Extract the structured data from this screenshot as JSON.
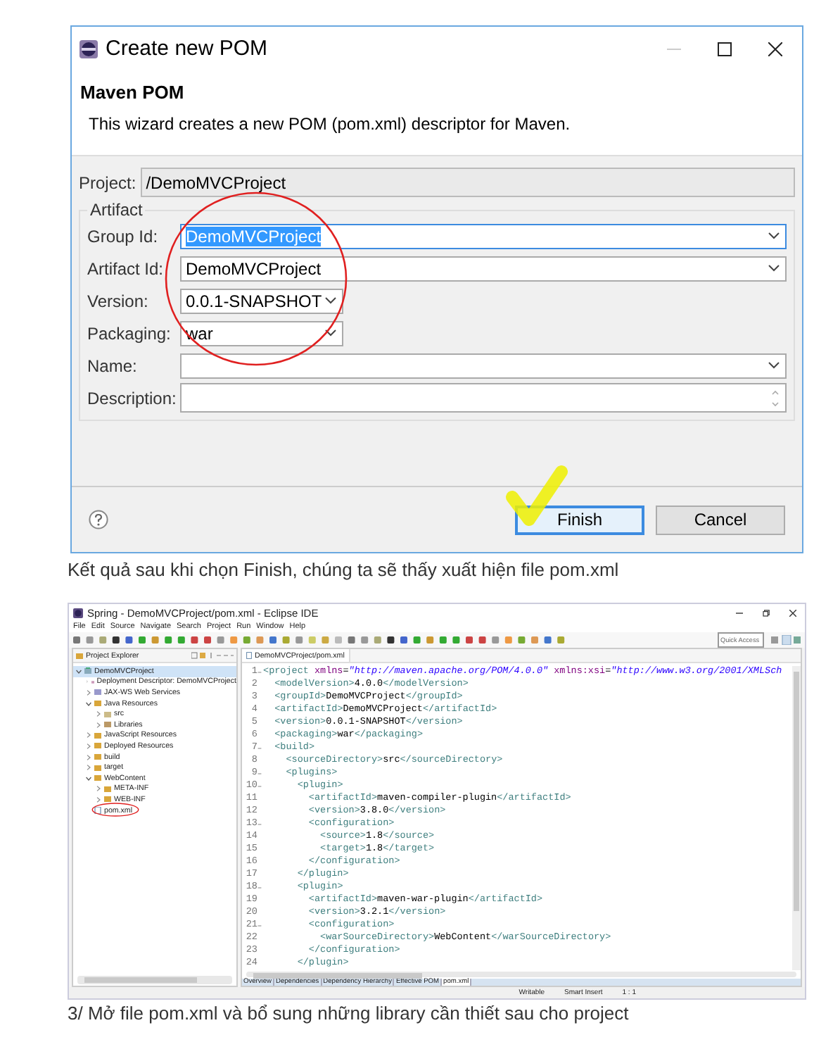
{
  "dialog": {
    "title": "Create new POM",
    "heading": "Maven POM",
    "description": "This wizard creates a new POM (pom.xml) descriptor for Maven.",
    "project": {
      "label": "Project:",
      "value": "/DemoMVCProject"
    },
    "group_title": "Artifact",
    "fields": [
      {
        "label": "Group Id:",
        "value": "DemoMVCProject",
        "kind": "combo",
        "selected": true
      },
      {
        "label": "Artifact Id:",
        "value": "DemoMVCProject",
        "kind": "combo",
        "selected": false
      },
      {
        "label": "Version:",
        "value": "0.0.1-SNAPSHOT",
        "kind": "short",
        "selected": false
      },
      {
        "label": "Packaging:",
        "value": "war",
        "kind": "short",
        "selected": false
      },
      {
        "label": "Name:",
        "kind": "combo",
        "selected": false
      },
      {
        "label": "Description:",
        "kind": "memo",
        "selected": false
      }
    ],
    "buttons": [
      {
        "label": "Finish",
        "default": true
      },
      {
        "label": "Cancel",
        "default": false
      }
    ]
  },
  "caption_1": "Kết quả sau khi chọn Finish, chúng ta sẽ thấy xuất hiện file pom.xml",
  "eclipse": {
    "title": "Spring - DemoMVCProject/pom.xml - Eclipse IDE",
    "menu": [
      "File",
      "Edit",
      "Source",
      "Navigate",
      "Search",
      "Project",
      "Run",
      "Window",
      "Help"
    ],
    "quick_access": {
      "placeholder": "Quick Access"
    },
    "explorer": {
      "title": "Project Explorer",
      "tree": [
        {
          "label": "DemoMVCProject",
          "kind": "project",
          "expanded": true,
          "selected": true,
          "marked": false,
          "children": [
            {
              "label": "Deployment Descriptor: DemoMVCProject",
              "kind": "descriptor",
              "expanded": false,
              "selected": false,
              "marked": false
            },
            {
              "label": "JAX-WS Web Services",
              "kind": "service",
              "expanded": false,
              "selected": false,
              "marked": false
            },
            {
              "label": "Java Resources",
              "kind": "folder",
              "expanded": true,
              "selected": false,
              "marked": false,
              "children": [
                {
                  "label": "src",
                  "kind": "package",
                  "expanded": false,
                  "selected": false,
                  "marked": false
                },
                {
                  "label": "Libraries",
                  "kind": "library",
                  "expanded": false,
                  "selected": false,
                  "marked": false
                }
              ]
            },
            {
              "label": "JavaScript Resources",
              "kind": "folder",
              "expanded": false,
              "selected": false,
              "marked": false
            },
            {
              "label": "Deployed Resources",
              "kind": "folder",
              "expanded": false,
              "selected": false,
              "marked": false
            },
            {
              "label": "build",
              "kind": "folder",
              "expanded": false,
              "selected": false,
              "marked": false
            },
            {
              "label": "target",
              "kind": "folder",
              "expanded": false,
              "selected": false,
              "marked": false
            },
            {
              "label": "WebContent",
              "kind": "folder",
              "expanded": true,
              "selected": false,
              "marked": false,
              "children": [
                {
                  "label": "META-INF",
                  "kind": "folder",
                  "expanded": false,
                  "selected": false,
                  "marked": false
                },
                {
                  "label": "WEB-INF",
                  "kind": "folder",
                  "expanded": false,
                  "selected": false,
                  "marked": false
                }
              ]
            },
            {
              "label": "pom.xml",
              "kind": "file",
              "selected": false,
              "marked": true
            }
          ]
        }
      ]
    },
    "editor": {
      "tab": "DemoMVCProject/pom.xml",
      "lines": [
        {
          "number": "1",
          "fold": true,
          "text": "<project xmlns=\"http://maven.apache.org/POM/4.0.0\" xmlns:xsi=\"http://www.w3.org/2001/XMLSch"
        },
        {
          "number": "2",
          "fold": false,
          "text": "  <modelVersion>4.0.0</modelVersion>"
        },
        {
          "number": "3",
          "fold": false,
          "text": "  <groupId>DemoMVCProject</groupId>"
        },
        {
          "number": "4",
          "fold": false,
          "text": "  <artifactId>DemoMVCProject</artifactId>"
        },
        {
          "number": "5",
          "fold": false,
          "text": "  <version>0.0.1-SNAPSHOT</version>"
        },
        {
          "number": "6",
          "fold": false,
          "text": "  <packaging>war</packaging>"
        },
        {
          "number": "7",
          "fold": true,
          "text": "  <build>"
        },
        {
          "number": "8",
          "fold": false,
          "text": "    <sourceDirectory>src</sourceDirectory>"
        },
        {
          "number": "9",
          "fold": true,
          "text": "    <plugins>"
        },
        {
          "number": "10",
          "fold": true,
          "text": "      <plugin>"
        },
        {
          "number": "11",
          "fold": false,
          "text": "        <artifactId>maven-compiler-plugin</artifactId>"
        },
        {
          "number": "12",
          "fold": false,
          "text": "        <version>3.8.0</version>"
        },
        {
          "number": "13",
          "fold": true,
          "text": "        <configuration>"
        },
        {
          "number": "14",
          "fold": false,
          "text": "          <source>1.8</source>"
        },
        {
          "number": "15",
          "fold": false,
          "text": "          <target>1.8</target>"
        },
        {
          "number": "16",
          "fold": false,
          "text": "        </configuration>"
        },
        {
          "number": "17",
          "fold": false,
          "text": "      </plugin>"
        },
        {
          "number": "18",
          "fold": true,
          "text": "      <plugin>"
        },
        {
          "number": "19",
          "fold": false,
          "text": "        <artifactId>maven-war-plugin</artifactId>"
        },
        {
          "number": "20",
          "fold": false,
          "text": "        <version>3.2.1</version>"
        },
        {
          "number": "21",
          "fold": true,
          "text": "        <configuration>"
        },
        {
          "number": "22",
          "fold": false,
          "text": "          <warSourceDirectory>WebContent</warSourceDirectory>"
        },
        {
          "number": "23",
          "fold": false,
          "text": "        </configuration>"
        },
        {
          "number": "24",
          "fold": false,
          "text": "      </plugin>"
        }
      ],
      "pages": [
        {
          "label": "Overview",
          "selected": false
        },
        {
          "label": "Dependencies",
          "selected": false
        },
        {
          "label": "Dependency Hierarchy",
          "selected": false
        },
        {
          "label": "Effective POM",
          "selected": false
        },
        {
          "label": "pom.xml",
          "selected": true
        }
      ]
    },
    "status_bar": [
      "Writable",
      "Smart Insert",
      "1 : 1"
    ]
  },
  "caption_2": "3/ Mở file pom.xml và bổ sung những library cần thiết sau cho project"
}
